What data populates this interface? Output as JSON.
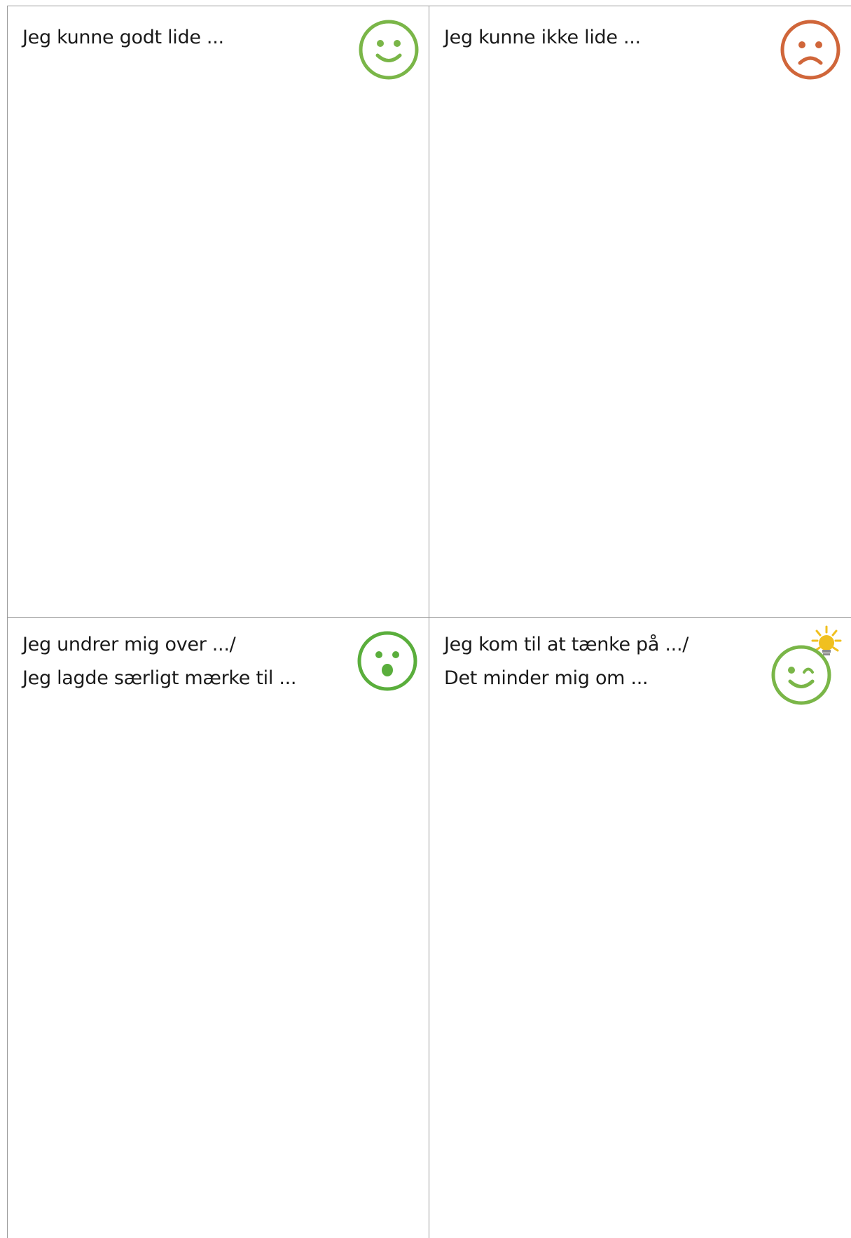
{
  "panels": {
    "liked": {
      "lines": [
        "Jeg kunne godt lide ..."
      ],
      "icon": "happy-face-icon",
      "color": "#7ab648"
    },
    "disliked": {
      "lines": [
        "Jeg kunne ikke lide ..."
      ],
      "icon": "sad-face-icon",
      "color": "#d0663a"
    },
    "wondered": {
      "lines": [
        "Jeg undrer mig over .../",
        "Jeg lagde særligt mærke til ..."
      ],
      "icon": "surprised-face-icon",
      "color": "#5aae3c"
    },
    "reminded": {
      "lines": [
        "Jeg kom til at tænke på .../",
        "Det minder mig om ..."
      ],
      "icon": "winking-face-with-lightbulb-icon",
      "color": "#7ab648",
      "bulb_color": "#f0c020"
    }
  }
}
